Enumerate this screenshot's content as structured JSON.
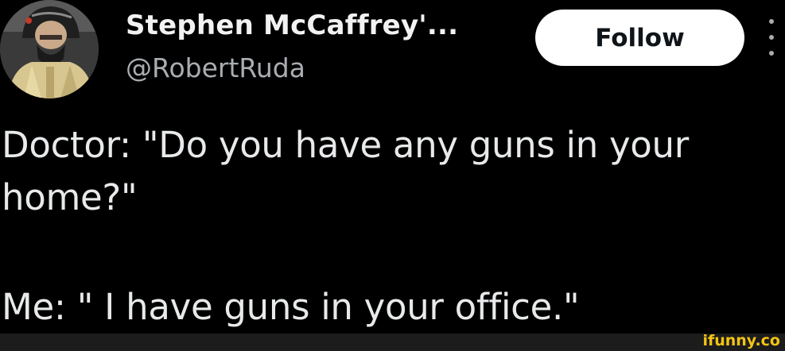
{
  "tweet": {
    "author": {
      "display_name": "Stephen McCaffrey'...",
      "handle": "@RobertRuda"
    },
    "follow_label": "Follow",
    "text_lines": [
      "Doctor: \"Do you have any guns in your",
      "home?\"",
      "Me: \" I have guns in your office.\""
    ]
  },
  "watermark": {
    "text": "ifunny.co"
  },
  "colors": {
    "background": "#000000",
    "text": "#e7e9ea",
    "secondary_text": "#a9adb1",
    "follow_button_bg": "#ffffff",
    "watermark": "#f4c414"
  },
  "icons": {
    "more": "more-vertical-icon",
    "avatar": "avatar-photo"
  }
}
